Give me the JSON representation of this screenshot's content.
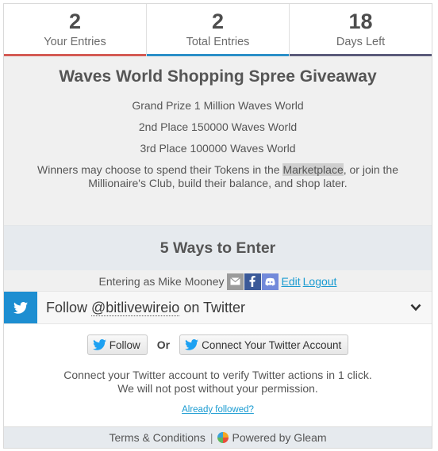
{
  "stats": [
    {
      "value": "2",
      "label": "Your Entries",
      "color": "#d45b54"
    },
    {
      "value": "2",
      "label": "Total Entries",
      "color": "#2b8fc8"
    },
    {
      "value": "18",
      "label": "Days Left",
      "color": "#5b5b7a"
    }
  ],
  "campaign": {
    "title": "Waves World Shopping Spree Giveaway",
    "prizes": [
      "Grand Prize 1 Million Waves World",
      "2nd Place 150000 Waves World",
      "3rd Place 100000 Waves World"
    ],
    "note_before": "Winners may choose to spend their Tokens in the ",
    "note_highlight": "Marketplace",
    "note_after": ", or join the Millionaire's Club, build their balance, and shop later."
  },
  "ways_title": "5 Ways to Enter",
  "user": {
    "entering_as": "Entering as Mike Mooney",
    "edit": "Edit",
    "logout": "Logout",
    "social_icons": [
      "email-icon",
      "facebook-icon",
      "discord-icon"
    ]
  },
  "entry": {
    "prefix": "Follow ",
    "handle": "@bitlivewireio",
    "suffix": " on Twitter",
    "follow_button": "Follow",
    "or": "Or",
    "connect_button": "Connect Your Twitter Account",
    "info_line1": "Connect your Twitter account to verify Twitter actions in 1 click.",
    "info_line2": "We will not post without your permission.",
    "already_followed": "Already followed?"
  },
  "footer": {
    "terms": "Terms & Conditions",
    "separator": "|",
    "powered": "Powered by Gleam"
  },
  "colors": {
    "twitter": "#1d8ed1",
    "link": "#1a9bd1"
  }
}
